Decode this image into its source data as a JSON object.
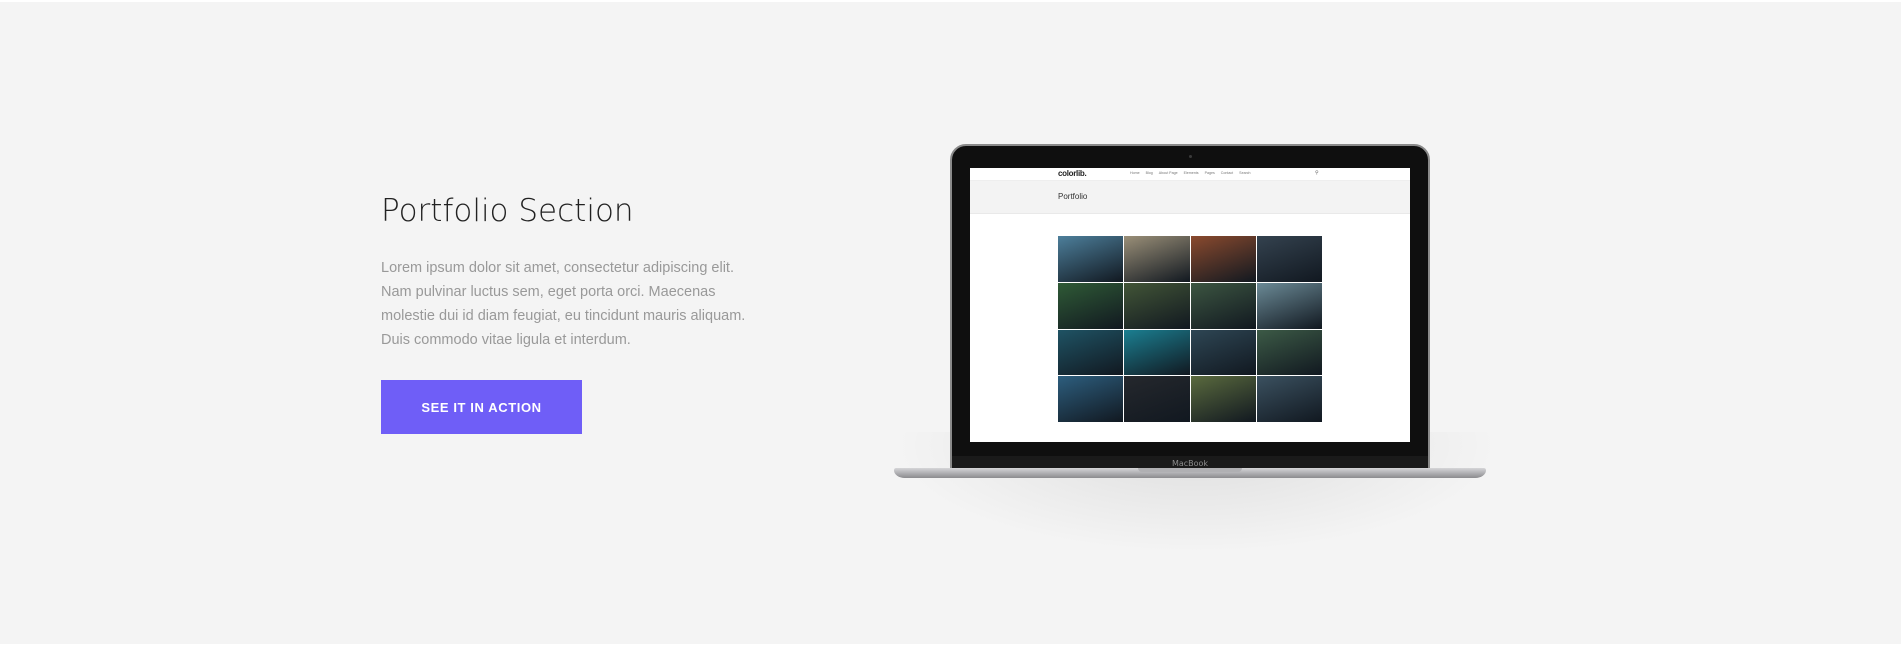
{
  "section": {
    "title": "Portfolio Section",
    "description": "Lorem ipsum dolor sit amet, consectetur adipiscing elit. Nam pulvinar luctus sem, eget porta orci. Maecenas molestie dui id diam feugiat, eu tincidunt mauris aliquam. Duis commodo vitae ligula et interdum.",
    "cta_label": "SEE IT IN ACTION",
    "accent_color": "#6f5ef7",
    "background_color": "#f4f4f4"
  },
  "laptop": {
    "brand_label": "MacBook",
    "screen": {
      "logo": "colorlib.",
      "menu_items": [
        "Home",
        "Blog",
        "About Page",
        "Elements",
        "Pages",
        "Contact",
        "Search"
      ],
      "search_icon": "search-icon",
      "page_title": "Portfolio"
    },
    "thumb_colors": [
      "#4d7f9b",
      "#9a8f78",
      "#8a4a2e",
      "#34424f",
      "#2f5a36",
      "#425537",
      "#3c5541",
      "#6b8a96",
      "#1f5364",
      "#1b7f91",
      "#2e4654",
      "#3c5a46",
      "#2d5e7e",
      "#25282d",
      "#5a6a3e",
      "#3b5160"
    ]
  }
}
